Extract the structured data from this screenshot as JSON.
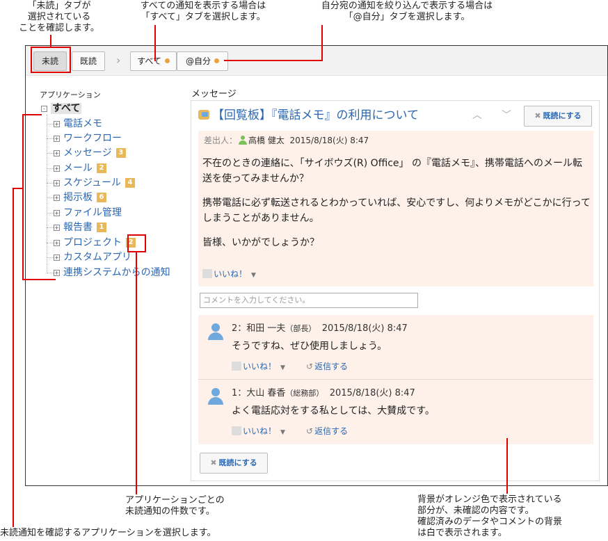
{
  "callouts": {
    "unread_tab": [
      "「未読」タブが",
      "選択されている",
      "ことを確認します。"
    ],
    "all_tab": [
      "すべての通知を表示する場合は",
      "「すべて」タブを選択します。"
    ],
    "mine_tab": [
      "自分宛の通知を絞り込んで表示する場合は",
      "「@自分」タブを選択します。"
    ],
    "count": [
      "アプリケーションごとの",
      "未読通知の件数です。"
    ],
    "select_app": [
      "未読通知を確認するアプリケーションを選択します。"
    ],
    "background": [
      "背景がオレンジ色で表示されている",
      "部分が、未確認の内容です。",
      "確認済みのデータやコメントの背景",
      "は白で表示されます。"
    ]
  },
  "tabs": {
    "unread": "未読",
    "read": "既読",
    "all": "すべて",
    "mine": "@自分",
    "chevron": "›"
  },
  "sidebar": {
    "title": "アプリケーション",
    "root": "すべて",
    "items": [
      {
        "label": "電話メモ",
        "badge": ""
      },
      {
        "label": "ワークフロー",
        "badge": ""
      },
      {
        "label": "メッセージ",
        "badge": "3"
      },
      {
        "label": "メール",
        "badge": "2"
      },
      {
        "label": "スケジュール",
        "badge": "4"
      },
      {
        "label": "掲示板",
        "badge": "6"
      },
      {
        "label": "ファイル管理",
        "badge": ""
      },
      {
        "label": "報告書",
        "badge": "1"
      },
      {
        "label": "プロジェクト",
        "badge": "2"
      },
      {
        "label": "カスタムアプリ",
        "badge": ""
      },
      {
        "label": "連携システムからの通知",
        "badge": ""
      }
    ]
  },
  "main": {
    "section_title": "メッセージ",
    "subject": "【回覧板】『電話メモ』の利用について",
    "up": "︿",
    "down": "﹀",
    "mark_read": "既読にする",
    "x": "✖",
    "sender_label": "差出人：",
    "sender_name": "高橋 健太",
    "sent_at": "2015/8/18(火) 8:47",
    "body": [
      "不在のときの連絡に、「サイボウズ(R) Office」 の『電話メモ』、携帯電話へのメール転送を使ってみませんか？",
      "携帯電話に必ず転送されるとわかっていれば、安心ですし、何よりメモがどこかに行ってしまうことがありません。",
      "皆様、いかがでしょうか？"
    ],
    "like": "いいね！",
    "caret": "▼",
    "reply": "返信する",
    "reply_icon": "↺",
    "comment_placeholder": "コメントを入力してください。",
    "comments": [
      {
        "no": "2：",
        "name": "和田 一夫",
        "role": "（部長）",
        "time": "2015/8/18(火) 8:47",
        "text": "そうですね、ぜひ使用しましょう。"
      },
      {
        "no": "1：",
        "name": "大山 春香",
        "role": "（総務部）",
        "time": "2015/8/18(火) 8:47",
        "text": "よく電話応対をする私としては、大賛成です。"
      }
    ]
  },
  "colors": {
    "accent": "#e00000",
    "link": "#2a67b2",
    "unread_bg": "#fdf1ea",
    "badge": "#e9b85a"
  }
}
